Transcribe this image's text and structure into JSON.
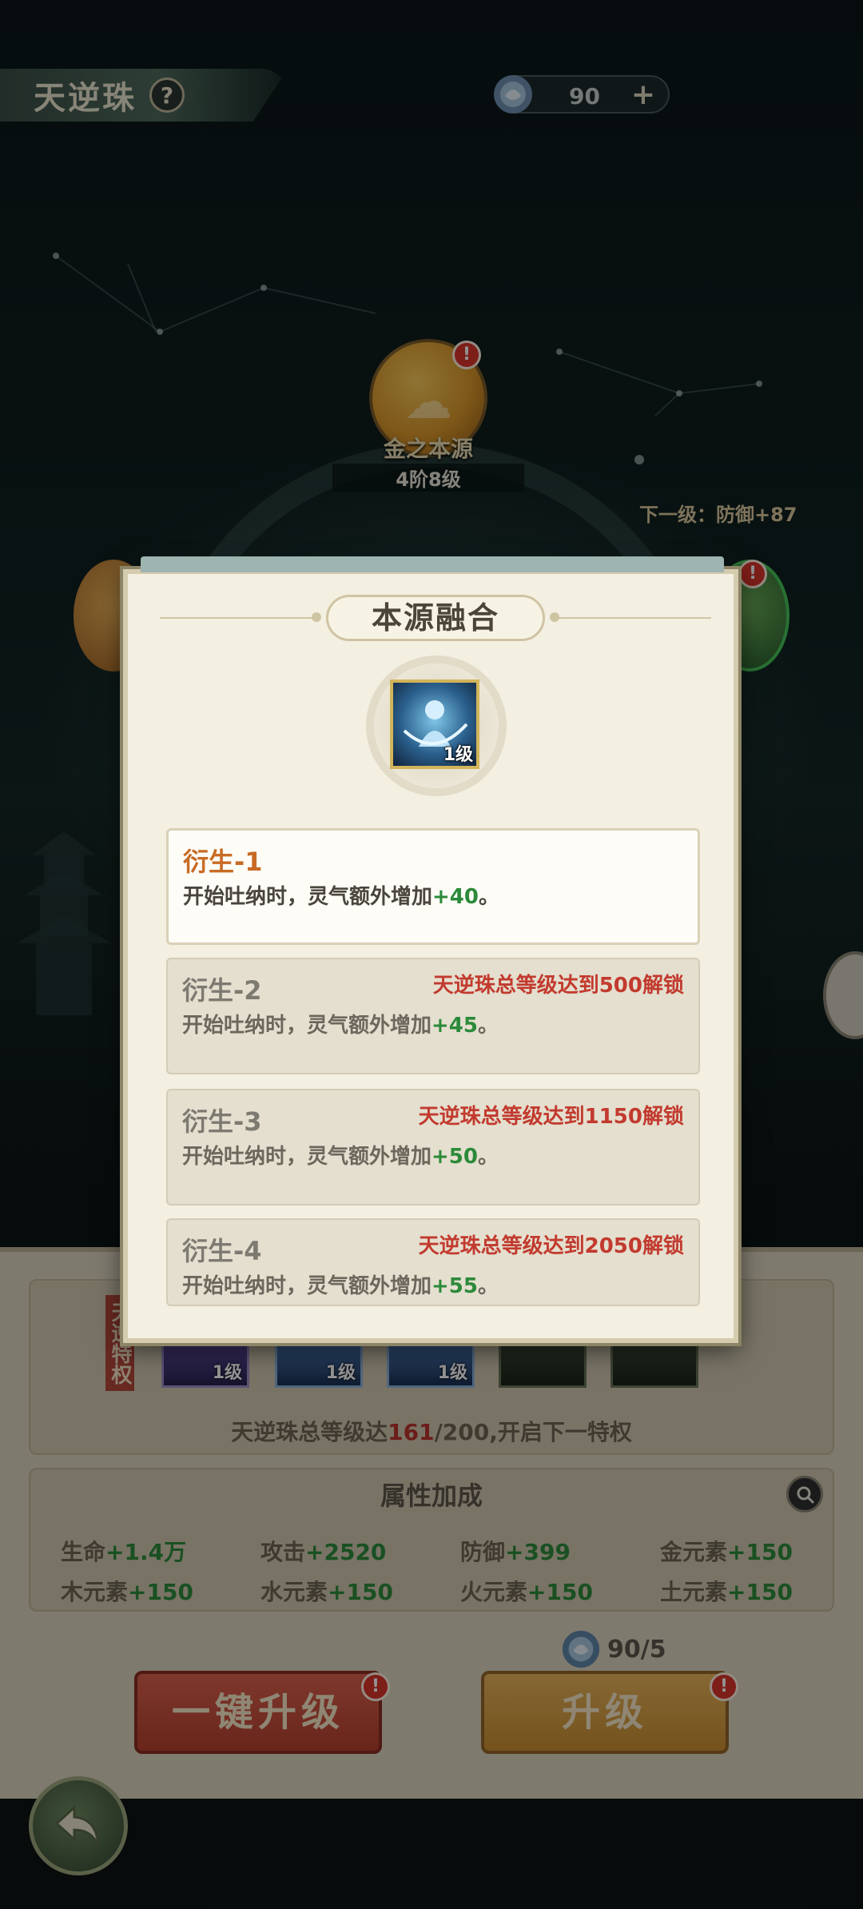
{
  "header": {
    "title": "天逆珠",
    "help_icon": "?",
    "currency": {
      "icon": "spirit-pearl-icon",
      "value": "90",
      "plus": "+"
    }
  },
  "scene": {
    "top_orb": {
      "name": "金之本源",
      "level": "4阶8级",
      "badge": "!"
    },
    "next_level_text": "下一级：防御+87",
    "right_orb_badge": "!"
  },
  "dialog": {
    "title": "本源融合",
    "skill_icon": {
      "icon": "water-spirit-icon",
      "level": "1级"
    },
    "entries": [
      {
        "title": "衍生-1",
        "lock": "",
        "desc": "开始吐纳时，灵气额外增加",
        "bonus": "+40",
        "end": "。",
        "active": true
      },
      {
        "title": "衍生-2",
        "lock": "天逆珠总等级达到500解锁",
        "desc": "开始吐纳时，灵气额外增加",
        "bonus": "+45",
        "end": "。",
        "active": false
      },
      {
        "title": "衍生-3",
        "lock": "天逆珠总等级达到1150解锁",
        "desc": "开始吐纳时，灵气额外增加",
        "bonus": "+50",
        "end": "。",
        "active": false
      },
      {
        "title": "衍生-4",
        "lock": "天逆珠总等级达到2050解锁",
        "desc": "开始吐纳时，灵气额外增加",
        "bonus": "+55",
        "end": "。",
        "active": false
      }
    ]
  },
  "privilege": {
    "slots": [
      {
        "level": "1级"
      },
      {
        "level": "1级"
      },
      {
        "level": "1级"
      }
    ],
    "progress_prefix": "天逆珠总等级达",
    "progress_current": "161",
    "progress_rest": "/200,开启下一特权"
  },
  "attributes": {
    "title": "属性加成",
    "items": [
      {
        "label": "生命",
        "value": "+1.4万"
      },
      {
        "label": "攻击",
        "value": "+2520"
      },
      {
        "label": "防御",
        "value": "+399"
      },
      {
        "label": "金元素",
        "value": "+150"
      },
      {
        "label": "木元素",
        "value": "+150"
      },
      {
        "label": "水元素",
        "value": "+150"
      },
      {
        "label": "火元素",
        "value": "+150"
      },
      {
        "label": "土元素",
        "value": "+150"
      }
    ]
  },
  "cost": {
    "value": "90/5"
  },
  "buttons": {
    "one_key_upgrade": "一键升级",
    "upgrade": "升级",
    "badge": "!"
  },
  "colors": {
    "accent_green": "#2c8a3a",
    "lock_red": "#c23a2e",
    "active_title": "#c86b25"
  }
}
